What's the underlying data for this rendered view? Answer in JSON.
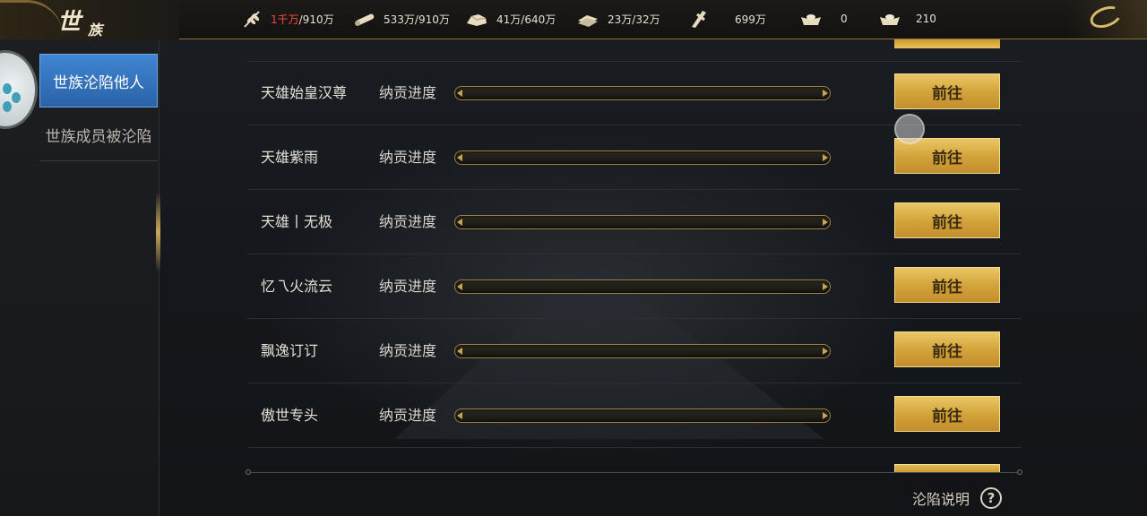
{
  "header": {
    "logo_main": "世",
    "logo_sub": "族",
    "resources": [
      {
        "icon": "wheat-icon",
        "value_highlight": "1千万",
        "value_rest": "/910万"
      },
      {
        "icon": "wood-icon",
        "value_highlight": "",
        "value_rest": "533万/910万"
      },
      {
        "icon": "stone-icon",
        "value_highlight": "",
        "value_rest": "41万/640万"
      },
      {
        "icon": "iron-icon",
        "value_highlight": "",
        "value_rest": "23万/32万"
      },
      {
        "icon": "copper-coin-icon",
        "value_highlight": "",
        "value_rest": "699万"
      },
      {
        "icon": "gold-ingot-icon",
        "value_highlight": "",
        "value_rest": "0"
      },
      {
        "icon": "silver-ingot-icon",
        "value_highlight": "",
        "value_rest": "210"
      }
    ]
  },
  "sidebar": {
    "tabs": [
      {
        "label": "世族沦陷他人",
        "active": true
      },
      {
        "label": "世族成员被沦陷",
        "active": false
      }
    ]
  },
  "list": {
    "progress_label": "纳贡进度",
    "button_label": "前往",
    "rows": [
      {
        "name": "天雄始皇汉尊",
        "progress": 0
      },
      {
        "name": "天雄紫雨",
        "progress": 0
      },
      {
        "name": "天雄丨无极",
        "progress": 0
      },
      {
        "name": "忆乁火流云",
        "progress": 0
      },
      {
        "name": "飘逸订订",
        "progress": 0
      },
      {
        "name": "傲世专头",
        "progress": 0
      }
    ]
  },
  "footer": {
    "help_label": "沦陷说明",
    "help_icon_glyph": "?"
  },
  "colors": {
    "accent_gold": "#d3a43c",
    "active_tab_blue": "#3f86d2",
    "highlight_red": "#ff4b3a"
  }
}
